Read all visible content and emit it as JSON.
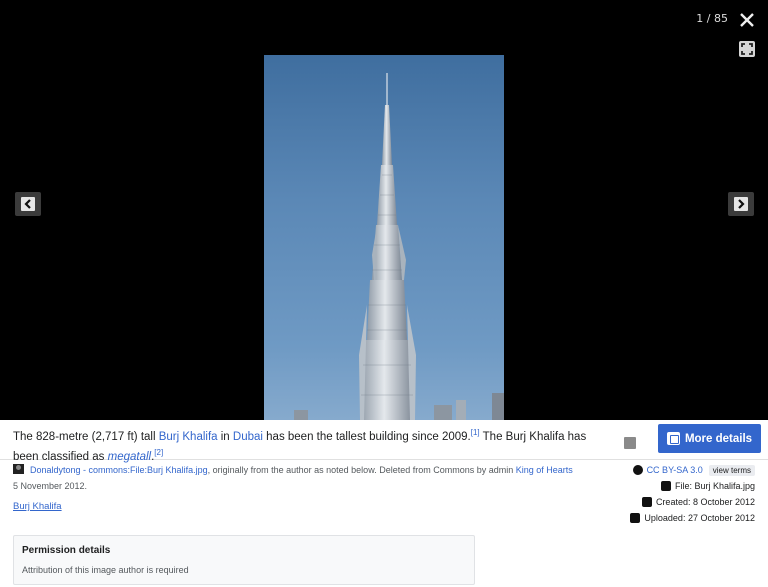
{
  "viewer": {
    "counter": "1 / 85",
    "close_icon": "close-icon",
    "fullscreen_icon": "fullscreen-icon",
    "prev_icon": "chevron-left-icon",
    "next_icon": "chevron-right-icon"
  },
  "caption": {
    "part1": "The 828-metre (2,717 ft) tall ",
    "link1": "Burj Khalifa",
    "part2": " in ",
    "link2": "Dubai",
    "part3": " has been the tallest building since 2009.",
    "ref1": "[1]",
    "part4": " The Burj Khalifa has been classified as ",
    "link3": "megatall",
    "part5": ".",
    "ref2": "[2]"
  },
  "more_details": {
    "label": "More details"
  },
  "author": {
    "link1": "Donaldytong - commons:File:Burj Khalifa.jpg",
    "text1": ", originally from the author as noted below. Deleted from Commons by admin ",
    "link2": "King of Hearts",
    "text2": " 5 November 2012."
  },
  "title_link": "Burj Khalifa",
  "meta": {
    "license": "CC BY-SA 3.0",
    "view_terms": "view terms",
    "file": "File: Burj Khalifa.jpg",
    "created": "Created: 8 October 2012",
    "uploaded": "Uploaded: 27 October 2012"
  },
  "permission": {
    "title": "Permission details",
    "text": "Attribution of this image author is required"
  },
  "colors": {
    "accent": "#3366cc",
    "viewer_bg": "#000000",
    "sky": "#5b88b6"
  }
}
